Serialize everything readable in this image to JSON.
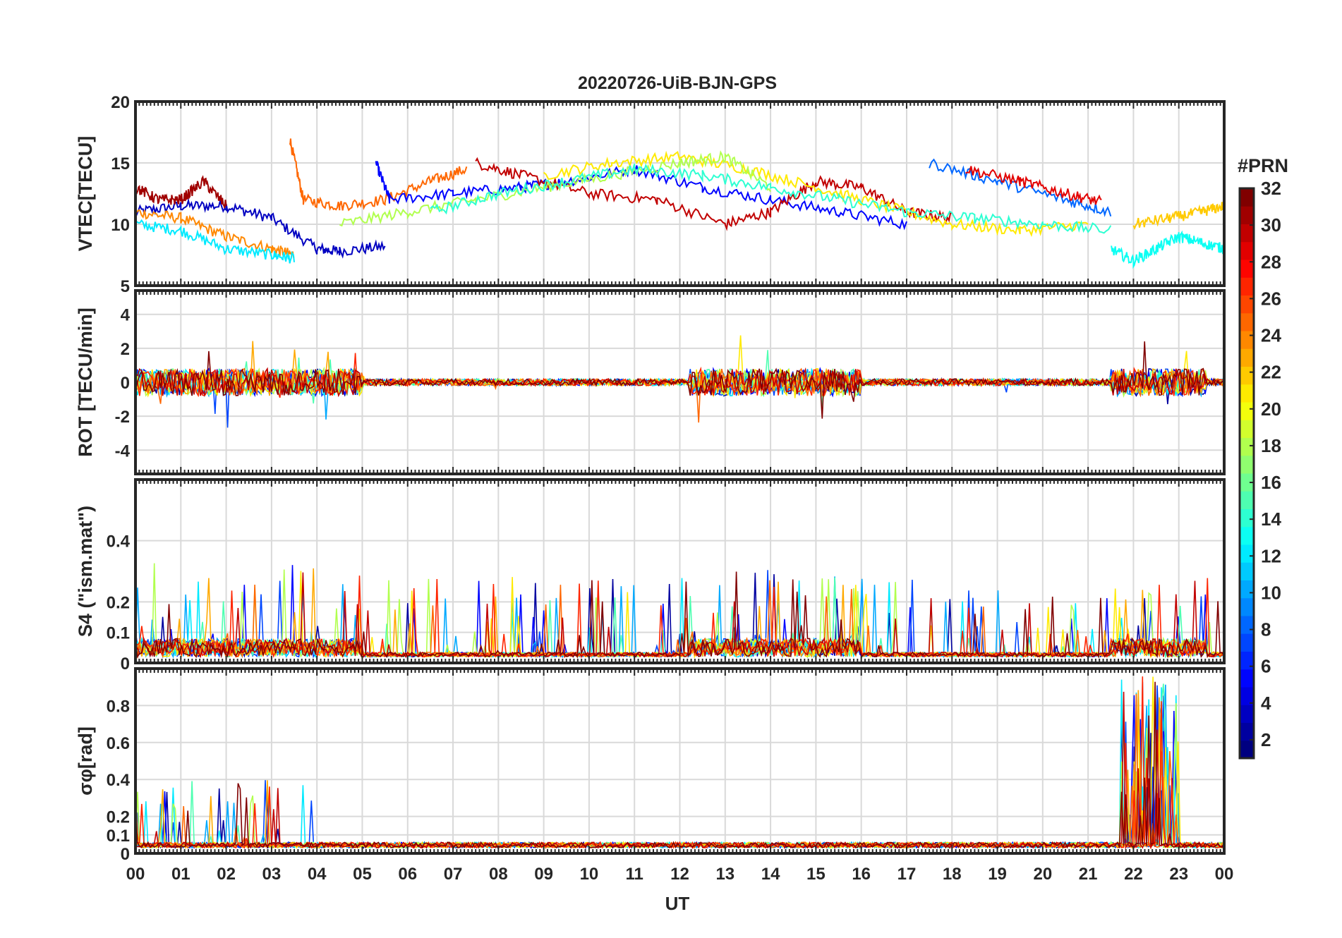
{
  "figure": {
    "title": "20220726-UiB-BJN-GPS",
    "xlabel": "UT",
    "x_ticks": [
      "00",
      "01",
      "02",
      "03",
      "04",
      "05",
      "06",
      "07",
      "08",
      "09",
      "10",
      "11",
      "12",
      "13",
      "14",
      "15",
      "16",
      "17",
      "18",
      "19",
      "20",
      "21",
      "22",
      "23",
      "00"
    ]
  },
  "colorbar": {
    "label": "#PRN",
    "ticks": [
      "2",
      "4",
      "6",
      "8",
      "10",
      "12",
      "14",
      "16",
      "18",
      "20",
      "22",
      "24",
      "26",
      "28",
      "30",
      "32"
    ],
    "range": [
      1,
      32
    ],
    "colormap": "jet"
  },
  "chart_data": [
    {
      "type": "line",
      "id": "vtec",
      "ylabel": "VTEC[TECU]",
      "ylim": [
        5,
        20
      ],
      "yticks": [
        "5",
        "10",
        "15",
        "20"
      ],
      "xlim_hours": [
        0,
        24
      ],
      "grid": true,
      "series_note": "one colored trace per GPS satellite PRN; values estimated",
      "series": [
        {
          "prn": 3,
          "x": [
            0,
            1,
            2,
            3,
            4,
            4.5,
            5.5
          ],
          "y": [
            11,
            11.5,
            11.5,
            10.5,
            8,
            7.8,
            8.2
          ]
        },
        {
          "prn": 24,
          "x": [
            0,
            1,
            2,
            3,
            3.5
          ],
          "y": [
            11,
            10.5,
            9,
            8,
            7.5
          ]
        },
        {
          "prn": 25,
          "x": [
            3.4,
            3.7,
            4.5,
            5.5,
            6.5,
            7.3
          ],
          "y": [
            17,
            12,
            11.5,
            12,
            13.5,
            14.5
          ]
        },
        {
          "prn": 12,
          "x": [
            0,
            1,
            2,
            3,
            3.5
          ],
          "y": [
            10,
            9.5,
            8,
            7.5,
            7.2
          ]
        },
        {
          "prn": 5,
          "x": [
            5.3,
            5.6,
            7,
            8.5,
            9.5,
            11,
            12.5,
            14,
            15.5,
            17
          ],
          "y": [
            15,
            12,
            12.5,
            13,
            13.5,
            14.5,
            13,
            12,
            11,
            10
          ]
        },
        {
          "prn": 30,
          "x": [
            7.5,
            8.5,
            10,
            11.5,
            13,
            14,
            15,
            16,
            17,
            18
          ],
          "y": [
            15,
            14,
            12.5,
            12,
            10,
            11,
            13.5,
            13,
            11,
            10.5
          ]
        },
        {
          "prn": 21,
          "x": [
            9,
            10.5,
            12,
            13.5,
            15,
            16.5,
            18,
            19.5,
            21
          ],
          "y": [
            14,
            15,
            15.5,
            14.5,
            13,
            11.5,
            10,
            9.5,
            10
          ]
        },
        {
          "prn": 18,
          "x": [
            4.5,
            6,
            7.5,
            9,
            10.5,
            12,
            13,
            14
          ],
          "y": [
            10,
            11,
            12,
            13,
            14,
            15,
            15.5,
            13
          ]
        },
        {
          "prn": 14,
          "x": [
            6.5,
            8,
            9.5,
            11,
            12.5,
            14,
            15.5,
            17,
            18.5,
            20,
            21.5
          ],
          "y": [
            11,
            12.5,
            13.5,
            14.5,
            14,
            13,
            12,
            11,
            10.5,
            10,
            9.5
          ]
        },
        {
          "prn": 8,
          "x": [
            17.5,
            19,
            20.5,
            21.5
          ],
          "y": [
            15,
            13.5,
            12,
            11
          ]
        },
        {
          "prn": 29,
          "x": [
            18.3,
            19.5,
            20.5,
            21.3
          ],
          "y": [
            14.5,
            13.5,
            12.5,
            11.8
          ]
        },
        {
          "prn": 13,
          "x": [
            21.5,
            22,
            22.5,
            23,
            23.5,
            24
          ],
          "y": [
            8,
            7,
            8,
            9,
            8.5,
            8
          ]
        },
        {
          "prn": 31,
          "x": [
            0,
            0.5,
            1,
            1.5,
            2
          ],
          "y": [
            13,
            12,
            12,
            13.5,
            11.5
          ]
        },
        {
          "prn": 22,
          "x": [
            22,
            22.8,
            23.5,
            24
          ],
          "y": [
            10,
            10.5,
            11,
            11.5
          ]
        }
      ]
    },
    {
      "type": "line",
      "id": "rot",
      "ylabel": "ROT [TECU/min]",
      "ylim": [
        -5.4,
        5.4
      ],
      "yticks": [
        "-4",
        "-2",
        "0",
        "2",
        "4"
      ],
      "xlim_hours": [
        0,
        24
      ],
      "grid": true,
      "series_note": "rate of TEC per PRN; fluctuations around 0 with bursts near 00-05, 12-16 and 21.5-23.5 UT"
    },
    {
      "type": "line",
      "id": "s4",
      "ylabel": "S4 (\"ism.mat\")",
      "ylim": [
        0,
        0.6
      ],
      "yticks": [
        "0",
        "0.1",
        "0.2",
        "0.4"
      ],
      "xlim_hours": [
        0,
        24
      ],
      "grid": true,
      "series_note": "amplitude scintillation index per PRN; peaks up to about 0.42"
    },
    {
      "type": "line",
      "id": "sigma_phi",
      "ylabel": "σφ[rad]",
      "ylim": [
        0,
        1
      ],
      "yticks": [
        "0",
        "0.1",
        "0.2",
        "0.4",
        "0.6",
        "0.8"
      ],
      "xlim_hours": [
        0,
        24
      ],
      "grid": true,
      "series_note": "phase scintillation index per PRN; large bursts near 21.7-23 UT up to 1"
    }
  ]
}
